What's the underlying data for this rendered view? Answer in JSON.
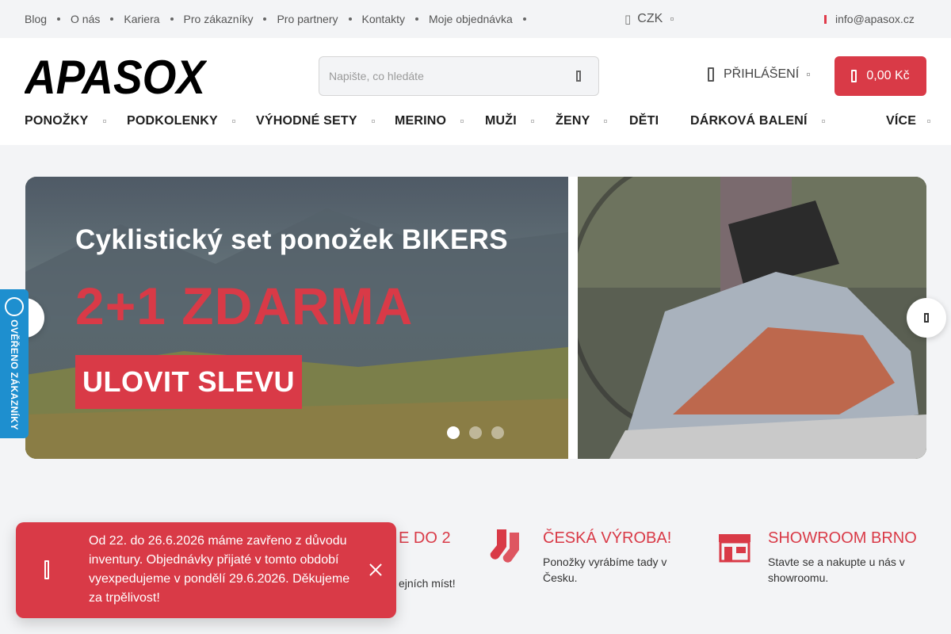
{
  "topbar": {
    "links": [
      "Blog",
      "O nás",
      "Kariera",
      "Pro zákazníky",
      "Pro partnery",
      "Kontakty",
      "Moje objednávka"
    ],
    "currency": "CZK",
    "email": "info@apasox.cz"
  },
  "header": {
    "logo_text": "APASOX",
    "search_placeholder": "Napište, co hledáte",
    "login_label": "PŘIHLÁŠENÍ",
    "cart_label": "0,00 Kč"
  },
  "nav": {
    "items": [
      {
        "label": "PONOŽKY",
        "has_dropdown": true
      },
      {
        "label": "PODKOLENKY",
        "has_dropdown": true
      },
      {
        "label": "VÝHODNÉ SETY",
        "has_dropdown": true
      },
      {
        "label": "MERINO",
        "has_dropdown": true
      },
      {
        "label": "MUŽI",
        "has_dropdown": true
      },
      {
        "label": "ŽENY",
        "has_dropdown": true
      },
      {
        "label": "DĚTI",
        "has_dropdown": false
      },
      {
        "label": "DÁRKOVÁ BALENÍ",
        "has_dropdown": true
      },
      {
        "label": "VÍCE",
        "has_dropdown": true
      }
    ]
  },
  "banner": {
    "title": "Cyklistický set ponožek BIKERS",
    "headline": "2+1 ZDARMA",
    "cta": "ULOVIT SLEVU",
    "slides": 3,
    "active_slide": 1
  },
  "verified_badge": {
    "label": "OVĚŘENO ZÁKAZNÍKY"
  },
  "features": [
    {
      "title": "E DO 2",
      "text": "ejních míst!",
      "icon": "truck-icon"
    },
    {
      "title": "ČESKÁ VÝROBA!",
      "text": "Ponožky vyrábíme tady v Česku.",
      "icon": "socks-icon"
    },
    {
      "title": "SHOWROOM BRNO",
      "text": "Stavte se a nakupte u nás v showroomu.",
      "icon": "store-icon"
    }
  ],
  "toast": {
    "message": "Od 22. do 26.6.2026 máme zavřeno z důvodu inventury. Objednávky přijaté v tomto období vyexpedujeme v pondělí 29.6.2026. Děkujeme za trpělivost!"
  },
  "colors": {
    "accent": "#d93a47",
    "badge_blue": "#1e8fcf",
    "background": "#f3f4f6"
  }
}
